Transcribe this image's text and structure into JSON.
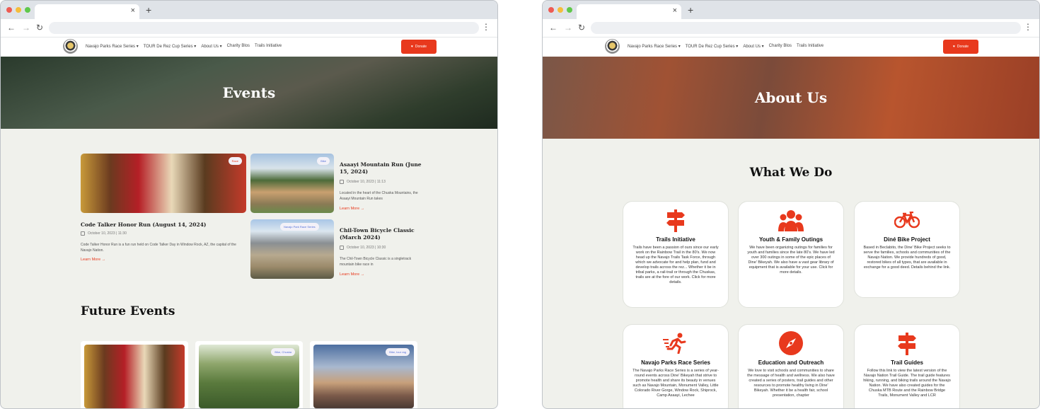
{
  "browser_left": {
    "tab_close": "×",
    "new_tab": "+"
  },
  "browser_right": {
    "tab_close": "×",
    "new_tab": "+"
  },
  "nav": {
    "items": [
      "Navajo Parks Race Series ▾",
      "TOUR De Rez Cup Series ▾",
      "About Us ▾",
      "Charity Blos",
      "Trails Initiative"
    ],
    "donate_label": "Donate"
  },
  "events_page": {
    "hero_title": "Events",
    "featured": {
      "badge": "Race",
      "title": "Code Talker Honor Run (August 14, 2024)",
      "date": "October 10, 2023 | 11:30",
      "desc": "Code Talker Honor Run is a fun run held on Code Talker Day in Window Rock, AZ, the capital of the Navajo Nation.",
      "learn_more": "Learn More →"
    },
    "side_events": [
      {
        "badge": "Bike",
        "title": "Asaayi Mountain Run (June 15, 2024)",
        "date": "October 10, 2023 | 11:13",
        "desc": "Located in the heart of the Chuska Mountains, the Asaayi Mountain Run takes",
        "learn_more": "Learn More →"
      },
      {
        "badge": "Navajo Park Race Series",
        "title": "Chil-Town Bicycle Classic (March 2024)",
        "date": "October 10, 2023 | 10:30",
        "desc": "The Chil-Town Bicycle Classic is a singletrack mountain bike race in",
        "learn_more": "Learn More →"
      }
    ],
    "future_title": "Future Events",
    "future_cards": [
      {
        "badge": ""
      },
      {
        "badge": "Bike, Chuska"
      },
      {
        "badge": "Bike, tour rag"
      }
    ]
  },
  "about_page": {
    "hero_title": "About Us",
    "section_title": "What We Do",
    "services": [
      {
        "icon": "signpost-icon",
        "title": "Trails Initiative",
        "text": "Trails have been a passion of ours since our early work on the Rainbow Trail in the 80's. We now head up the Navajo Trails Task Force, through which we advocate for and help plan, fund and develop trails across the rez... Whether it be in tribal parks, a rail-trail or through the Chuskas, trails are at the fore of our work. Click for more details."
      },
      {
        "icon": "group-icon",
        "title": "Youth & Family Outings",
        "text": "We have been organizing outings for families for youth and families since the late 80's. We have led over 300 outings in some of the epic places of Dine' Bikeyah. We also have a vast gear library of equipment that is available for your use. Click for more details."
      },
      {
        "icon": "bicycle-icon",
        "title": "Diné Bike Project",
        "text": "Based in Beclabito, the Dine' Bike Project seeks to serve the families, schools and communities of the Navajo Nation. We provide hundreds of good, restored bikes of all types, that are available in exchange for a good deed. Details behind the link."
      },
      {
        "icon": "runner-icon",
        "title": "Navajo Parks Race Series",
        "text": "The Navajo Parks Race Series is a series of year-round events across Dine' Bikeyah that strive to promote health and share its beauty in venues such as Navajo Mountain, Monument Valley, Little Colorado River Gorge, Window Rock, Shiprock, Camp Asaayi, Lechee"
      },
      {
        "icon": "compass-icon",
        "title": "Education and Outreach",
        "text": "We love to visit schools and communities to share the message of health and wellness. We also have created a series of posters, trail guides and other resources to promote healthy living in Dine' Bikeyah. Whether it be a health fair, school presentation, chapter"
      },
      {
        "icon": "signpost-icon",
        "title": "Trail Guides",
        "text": "Follow this link to view the latest version of the Navajo Nation Trail Guide. The trail guide features hiking, running, and biking trails around the Navajo Nation. We have also created guides for the Chuska MTB Route and the Rainbow Bridge Trails, Monument Valley and LCR"
      }
    ]
  },
  "colors": {
    "accent": "#e8391d",
    "page_bg": "#f0f1ec"
  }
}
